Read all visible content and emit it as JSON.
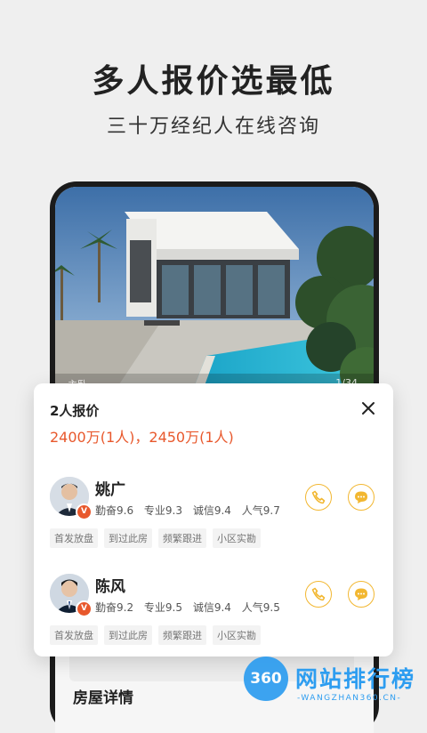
{
  "headline": "多人报价选最低",
  "subline": "三十万经纪人在线咨询",
  "hero": {
    "label": "主卧",
    "counter": "1/34"
  },
  "section": {
    "house_details": "房屋详情"
  },
  "sheet": {
    "title": "2人报价",
    "prices": "2400万(1人)，2450万(1人)",
    "price_color": "#e8582c",
    "agents": [
      {
        "name": "姚广",
        "badge": "V",
        "scores": [
          "勤奋9.6",
          "专业9.3",
          "诚信9.4",
          "人气9.7"
        ],
        "tags": [
          "首发放盘",
          "到过此房",
          "频繁跟进",
          "小区实勘"
        ]
      },
      {
        "name": "陈风",
        "badge": "V",
        "scores": [
          "勤奋9.2",
          "专业9.5",
          "诚信9.4",
          "人气9.5"
        ],
        "tags": [
          "首发放盘",
          "到过此房",
          "频繁跟进",
          "小区实勘"
        ]
      }
    ]
  },
  "watermark": {
    "logo": "360",
    "text": "网站排行榜",
    "url": "-WANGZHAN360.CN-"
  },
  "colors": {
    "accent": "#f2b731",
    "badge": "#e8582c",
    "watermark": "#2d9df0"
  },
  "icons": {
    "close": "close-icon",
    "phone": "phone-icon",
    "chat": "chat-icon"
  }
}
